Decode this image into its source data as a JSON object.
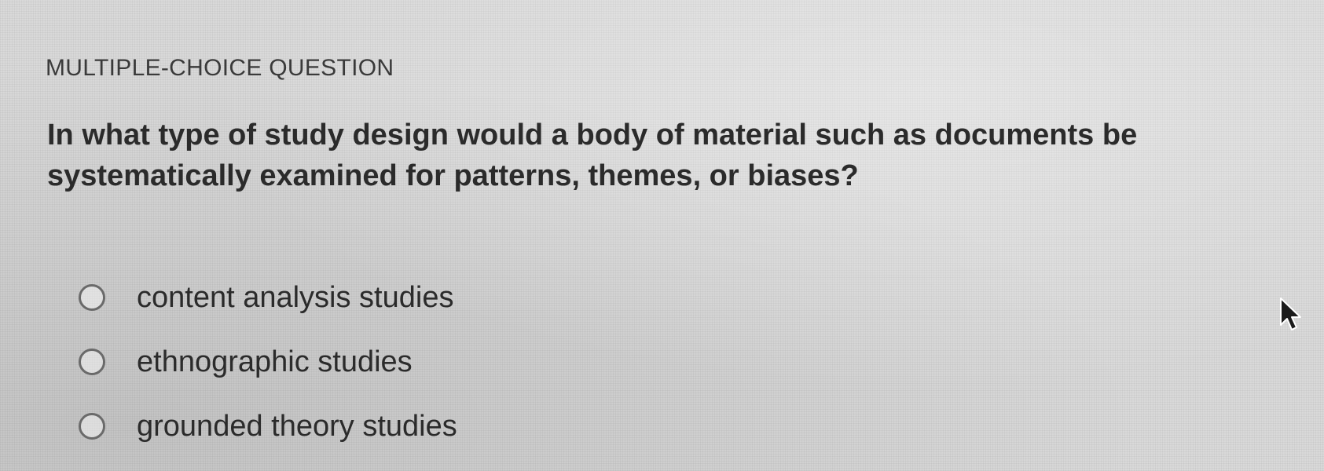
{
  "question": {
    "type_label": "MULTIPLE-CHOICE QUESTION",
    "text": "In what type of study design would a body of material such as documents be systematically examined for patterns, themes, or biases?"
  },
  "options": [
    {
      "label": "content analysis studies",
      "selected": false
    },
    {
      "label": "ethnographic studies",
      "selected": false
    },
    {
      "label": "grounded theory studies",
      "selected": false
    }
  ],
  "colors": {
    "background": "#d9d9d9",
    "text": "#2b2b2b",
    "radio_border": "#6a6a6a"
  },
  "icons": {
    "cursor": "mouse-pointer-icon"
  }
}
